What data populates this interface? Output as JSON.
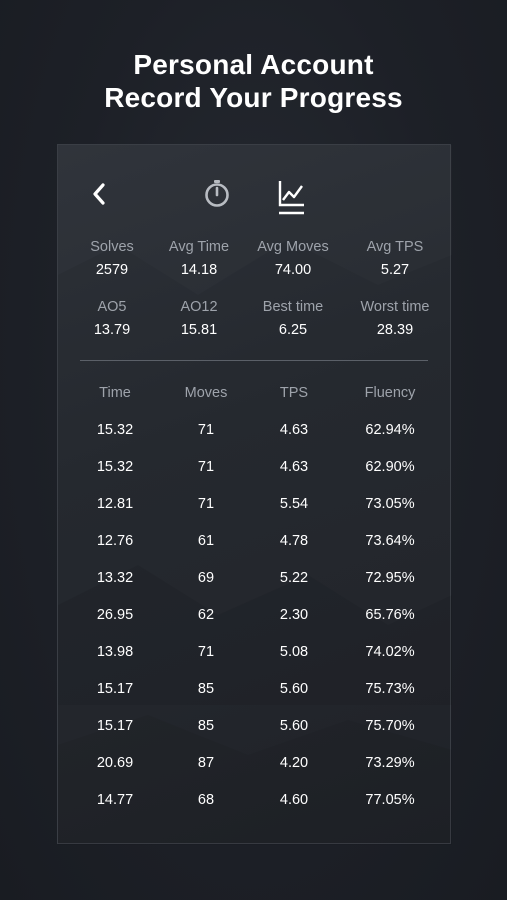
{
  "hero": {
    "line1": "Personal Account",
    "line2": "Record Your Progress"
  },
  "nav": {
    "back_icon": "chevron-left-icon",
    "timer_icon": "stopwatch-icon",
    "stats_icon": "chart-icon",
    "active": "stats"
  },
  "summary": [
    {
      "label": "Solves",
      "value": "2579"
    },
    {
      "label": "Avg Time",
      "value": "14.18"
    },
    {
      "label": "Avg Moves",
      "value": "74.00"
    },
    {
      "label": "Avg TPS",
      "value": "5.27"
    },
    {
      "label": "AO5",
      "value": "13.79"
    },
    {
      "label": "AO12",
      "value": "15.81"
    },
    {
      "label": "Best time",
      "value": "6.25"
    },
    {
      "label": "Worst time",
      "value": "28.39"
    }
  ],
  "table": {
    "headers": [
      "Time",
      "Moves",
      "TPS",
      "Fluency"
    ],
    "rows": [
      [
        "15.32",
        "71",
        "4.63",
        "62.94%"
      ],
      [
        "15.32",
        "71",
        "4.63",
        "62.90%"
      ],
      [
        "12.81",
        "71",
        "5.54",
        "73.05%"
      ],
      [
        "12.76",
        "61",
        "4.78",
        "73.64%"
      ],
      [
        "13.32",
        "69",
        "5.22",
        "72.95%"
      ],
      [
        "26.95",
        "62",
        "2.30",
        "65.76%"
      ],
      [
        "13.98",
        "71",
        "5.08",
        "74.02%"
      ],
      [
        "15.17",
        "85",
        "5.60",
        "75.73%"
      ],
      [
        "15.17",
        "85",
        "5.60",
        "75.70%"
      ],
      [
        "20.69",
        "87",
        "4.20",
        "73.29%"
      ],
      [
        "14.77",
        "68",
        "4.60",
        "77.05%"
      ]
    ]
  },
  "colors": {
    "background": "#1d2027",
    "card": "#2a2e35",
    "label": "#9ea3ab",
    "value": "#ffffff",
    "divider": "#5b6068"
  }
}
